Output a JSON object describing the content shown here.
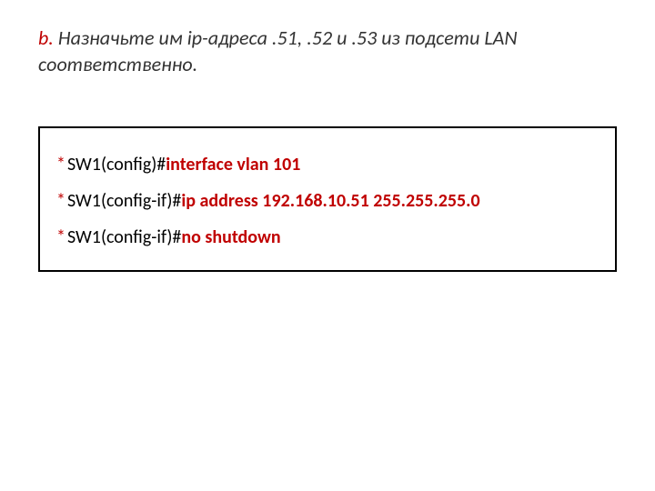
{
  "heading": {
    "label": "b.",
    "text": "Назначьте им ip-адреса .51, .52 и .53 из подсети LAN соответственно."
  },
  "lines": [
    {
      "prompt": "SW1(config)#",
      "cmd": "interface vlan 101"
    },
    {
      "prompt": "SW1(config-if)#",
      "cmd": "ip address 192.168.10.51 255.255.255.0"
    },
    {
      "prompt": "SW1(config-if)#",
      "cmd": "no shutdown"
    }
  ],
  "bullet": "*"
}
